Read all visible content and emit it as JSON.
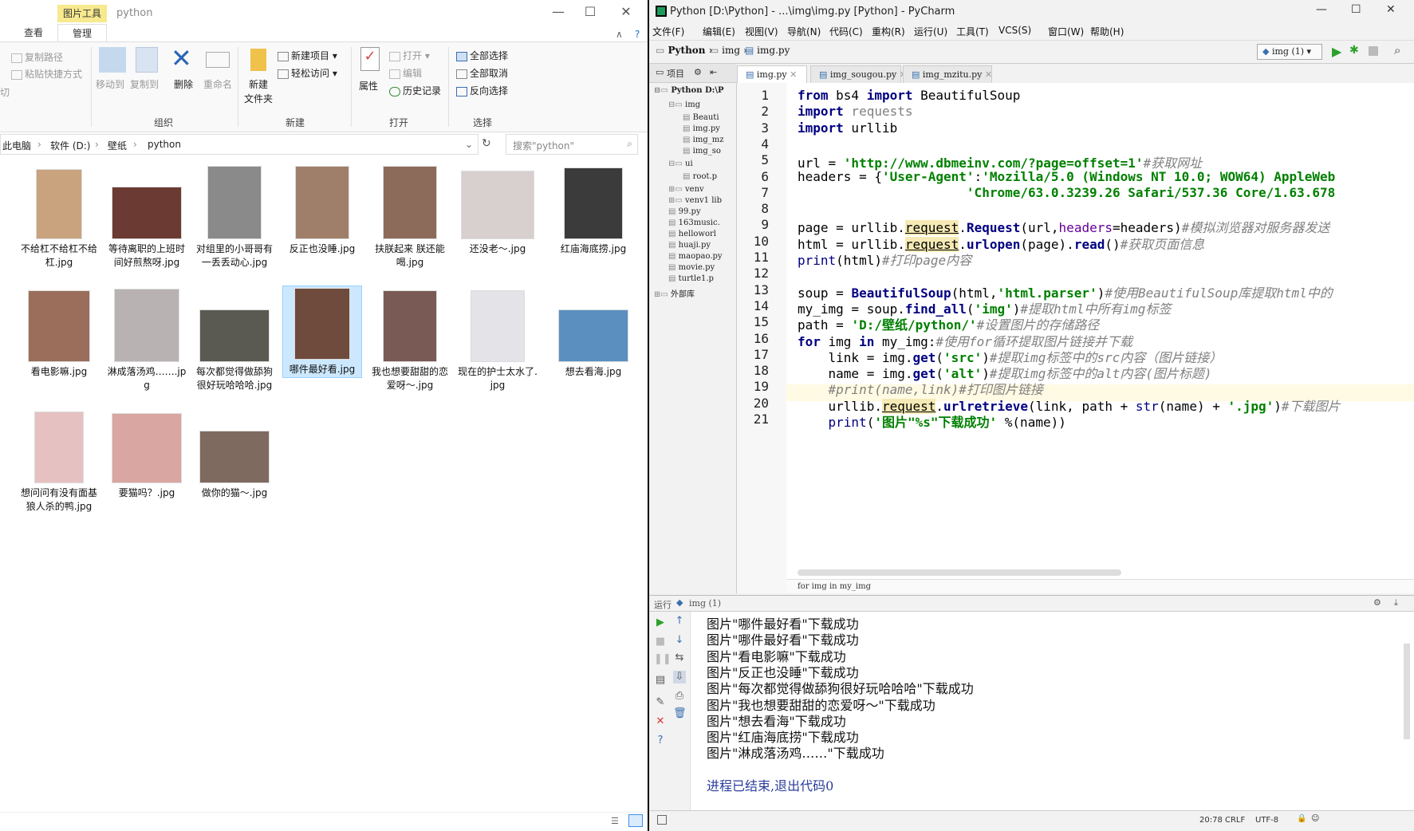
{
  "explorer": {
    "context_tab": "图片工具",
    "window_title": "python",
    "window_buttons": {
      "minimize": "—",
      "maximize": "☐",
      "close": "✕"
    },
    "ribbon_tabs": [
      "查看",
      "管理"
    ],
    "clipboard": {
      "copy_path": "复制路径",
      "paste_shortcut": "粘贴快捷方式"
    },
    "organize": {
      "move_to": "移动到",
      "copy_to": "复制到",
      "delete": "删除",
      "rename": "重命名",
      "label": "组织"
    },
    "new": {
      "new_folder_line1": "新建",
      "new_folder_line2": "文件夹",
      "new_item": "新建项目",
      "easy_access": "轻松访问",
      "label": "新建"
    },
    "open": {
      "properties": "属性",
      "open": "打开",
      "edit": "编辑",
      "history": "历史记录",
      "label": "打开"
    },
    "select": {
      "select_all": "全部选择",
      "select_none": "全部取消",
      "invert": "反向选择",
      "label": "选择"
    },
    "address": [
      "此电脑",
      "软件 (D:)",
      "壁纸",
      "python"
    ],
    "search_placeholder": "搜索\"python\"",
    "files": [
      {
        "name": "不给杠不给杠不给杠.jpg",
        "color": "#c9a27e"
      },
      {
        "name": "等待离职的上班时间好煎熬呀.jpg",
        "color": "#6b3a32"
      },
      {
        "name": "对组里的小哥哥有一丢丢动心.jpg",
        "color": "#8a8a8a"
      },
      {
        "name": "反正也没睡.jpg",
        "color": "#a07f6a"
      },
      {
        "name": "扶朕起来 朕还能喝.jpg",
        "color": "#8d6b5a"
      },
      {
        "name": "还没老～.jpg",
        "color": "#d8cfcf"
      },
      {
        "name": "红庙海底捞.jpg",
        "color": "#3b3b3b"
      },
      {
        "name": "看电影嘛.jpg",
        "color": "#9a6e5b"
      },
      {
        "name": "淋成落汤鸡…….jpg",
        "color": "#b8b2b2"
      },
      {
        "name": "每次都觉得做舔狗很好玩哈哈哈.jpg",
        "color": "#5a5a52"
      },
      {
        "name": "哪件最好看.jpg",
        "color": "#6e4b3d"
      },
      {
        "name": "我也想要甜甜的恋爱呀～.jpg",
        "color": "#7a5a55"
      },
      {
        "name": "现在的护士太水了.jpg",
        "color": "#e3e3e8"
      },
      {
        "name": "想去看海.jpg",
        "color": "#5b8fc0"
      },
      {
        "name": "想问问有没有面基狼人杀的鸭.jpg",
        "color": "#e6c1c1"
      },
      {
        "name": "要猫吗？.jpg",
        "color": "#d9a6a2"
      },
      {
        "name": "做你的猫～.jpg",
        "color": "#7f6a60"
      }
    ]
  },
  "pycharm": {
    "title": "Python [D:\\Python] - ...\\img\\img.py [Python] - PyCharm",
    "menu": [
      "文件(F)",
      "编辑(E)",
      "视图(V)",
      "导航(N)",
      "代码(C)",
      "重构(R)",
      "运行(U)",
      "工具(T)",
      "VCS(S)",
      "窗口(W)",
      "帮助(H)"
    ],
    "nav": [
      "Python",
      "img",
      "img.py"
    ],
    "run_config": "img (1)",
    "tabs": [
      "img.py",
      "img_sougou.py",
      "img_mzitu.py"
    ],
    "project_label": "项目",
    "tree": [
      {
        "text": "Python  D:\\P",
        "indent": 0
      },
      {
        "text": "img",
        "indent": 1
      },
      {
        "text": "Beauti",
        "indent": 2
      },
      {
        "text": "img.py",
        "indent": 2
      },
      {
        "text": "img_mz",
        "indent": 2
      },
      {
        "text": "img_so",
        "indent": 2
      },
      {
        "text": "ui",
        "indent": 1
      },
      {
        "text": "root.p",
        "indent": 2
      },
      {
        "text": "venv",
        "indent": 1
      },
      {
        "text": "venv1  lib",
        "indent": 1
      },
      {
        "text": "99.py",
        "indent": 1
      },
      {
        "text": "163music.",
        "indent": 1
      },
      {
        "text": "helloworl",
        "indent": 1
      },
      {
        "text": "huaji.py",
        "indent": 1
      },
      {
        "text": "maopao.py",
        "indent": 1
      },
      {
        "text": "movie.py",
        "indent": 1
      },
      {
        "text": "turtle1.p",
        "indent": 1
      },
      {
        "text": "外部库",
        "indent": 0
      }
    ],
    "line_numbers": [
      "1",
      "2",
      "3",
      "4",
      "5",
      "6",
      "7",
      "8",
      "9",
      "10",
      "11",
      "12",
      "13",
      "14",
      "15",
      "16",
      "17",
      "18",
      "19",
      "20",
      "21"
    ],
    "code_text": {
      "l1": [
        "from",
        " bs4 ",
        "import",
        " BeautifulSoup"
      ],
      "l2": [
        "import",
        " requests"
      ],
      "l3": [
        "import",
        " urllib"
      ],
      "l5": [
        "url = ",
        "'http://www.dbmeinv.com/?page=offset=1'",
        "#获取网址"
      ],
      "l6": [
        "headers = {",
        "'User-Agent'",
        ":",
        "'Mozilla/5.0 (Windows NT 10.0; WOW64) AppleWeb"
      ],
      "l7": [
        "                      ",
        "'Chrome/63.0.3239.26 Safari/537.36 Core/1.63.678"
      ],
      "l9": [
        "page = urllib.",
        "request",
        ".",
        "Request",
        "(url,",
        "headers",
        "=headers)",
        "#模拟浏览器对服务器发送"
      ],
      "l10": [
        "html = urllib.",
        "request",
        ".",
        "urlopen",
        "(page).",
        "read",
        "()",
        "#获取页面信息"
      ],
      "l11": [
        "print",
        "(html)",
        "#打印page内容"
      ],
      "l13": [
        "soup = ",
        "BeautifulSoup",
        "(html,",
        "'html.parser'",
        ")",
        "#使用BeautifulSoup库提取html中的"
      ],
      "l14": [
        "my_img = soup.",
        "find_all",
        "(",
        "'img'",
        ")",
        "#提取html中所有img标签"
      ],
      "l15": [
        "path = ",
        "'D:/壁纸/python/'",
        "#设置图片的存储路径"
      ],
      "l16": [
        "for",
        " img ",
        "in",
        " my_img:",
        "#使用for循环提取图片链接并下载"
      ],
      "l17": [
        "    link = img.",
        "get",
        "(",
        "'src'",
        ")",
        "#提取img标签中的src内容（图片链接）"
      ],
      "l18": [
        "    name = img.",
        "get",
        "(",
        "'alt'",
        ")",
        "#提取img标签中的alt内容(图片标题)"
      ],
      "l19": [
        "    #print(name,link)#打印图片链接"
      ],
      "l20": [
        "    urllib.",
        "request",
        ".",
        "urlretrieve",
        "(link, path + ",
        "str",
        "(name) + ",
        "'.jpg'",
        ")",
        "#下载图片"
      ],
      "l21": [
        "    ",
        "print",
        "(",
        "'图片\"%s\"下载成功'",
        " %(name))"
      ]
    },
    "breadcrumb": "for img in my_img",
    "run_label": "运行",
    "run_tab": "img (1)",
    "output": [
      "图片\"哪件最好看\"下载成功",
      "图片\"哪件最好看\"下载成功",
      "图片\"看电影嘛\"下载成功",
      "图片\"反正也没睡\"下载成功",
      "图片\"每次都觉得做舔狗很好玩哈哈哈\"下载成功",
      "图片\"我也想要甜甜的恋爱呀～\"下载成功",
      "图片\"想去看海\"下载成功",
      "图片\"红庙海底捞\"下载成功",
      "图片\"淋成落汤鸡……\"下载成功",
      "",
      "进程已结束,退出代码0"
    ],
    "status": {
      "position": "20:78",
      "line_sep": "CRLF",
      "encoding": "UTF-8"
    }
  }
}
